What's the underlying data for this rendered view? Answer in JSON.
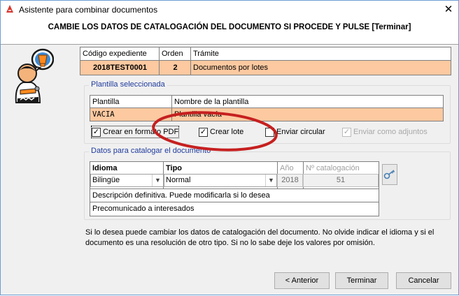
{
  "window": {
    "title": "Asistente para combinar documentos",
    "close_glyph": "✕",
    "header": "CAMBIE LOS DATOS DE CATALOGACIÓN DEL DOCUMENTO SI PROCEDE Y PULSE [Terminar]"
  },
  "expediente": {
    "headers": [
      "Código expediente",
      "Orden",
      "Trámite"
    ],
    "values": [
      "2018TEST0001",
      "2",
      "Documentos por lotes"
    ]
  },
  "plantilla": {
    "group_title": "Plantilla seleccionada",
    "headers": [
      "Plantilla",
      "Nombre de la plantilla"
    ],
    "values": [
      "VACIA",
      "Plantilla vacía"
    ],
    "options": [
      {
        "label": "Crear en formato PDF",
        "checked": true,
        "enabled": true
      },
      {
        "label": "Crear lote",
        "checked": true,
        "enabled": true
      },
      {
        "label": "Enviar circular",
        "checked": false,
        "enabled": true
      },
      {
        "label": "Enviar como adjuntos",
        "checked": true,
        "enabled": false
      }
    ]
  },
  "catalogo": {
    "group_title": "Datos para catalogar el documento",
    "headers": [
      "Idioma",
      "Tipo",
      "Año",
      "Nº catalogación"
    ],
    "idioma": "Bilingüe",
    "tipo": "Normal",
    "anio": "2018",
    "num_catalogacion": "51",
    "descripcion_header": "Descripción definitiva. Puede modificarla si lo desea",
    "descripcion": "Precomunicado a interesados"
  },
  "info_text": "Si lo desea puede cambiar los datos de catalogación del documento. No olvide indicar el idioma y si el documento es una resolución de otro tipo. Si no lo sabe deje los valores por omisión.",
  "buttons": {
    "anterior": "< Anterior",
    "terminar": "Terminar",
    "cancelar": "Cancelar"
  },
  "icons": {
    "app": "app-icon",
    "wizard": "wizard-figure-icon",
    "key": "key-icon",
    "check": "✓",
    "dropdown": "▼"
  },
  "colors": {
    "highlight_row": "#fcc9a0",
    "annotation": "#c62020",
    "group_title": "#1f3b9d"
  }
}
